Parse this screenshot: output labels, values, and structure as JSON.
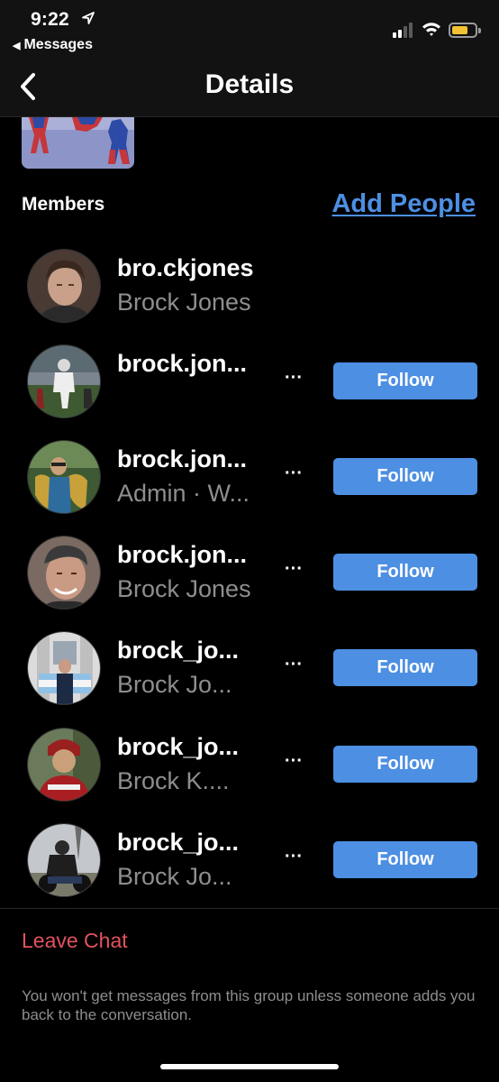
{
  "status_bar": {
    "time": "9:22",
    "back_app": "Messages",
    "signal_bars_on": 2,
    "battery_color": "#f1c232"
  },
  "nav": {
    "title": "Details"
  },
  "members_section": {
    "label": "Members",
    "add_people_label": "Add People",
    "accent_color": "#4d8fe3"
  },
  "members": [
    {
      "username": "bro.ckjones",
      "subtitle": "Brock Jones",
      "more": "",
      "follow": ""
    },
    {
      "username": "brock.jon...",
      "subtitle": "",
      "more": "···",
      "follow": "Follow"
    },
    {
      "username": "brock.jon...",
      "subtitle": "Admin · W...",
      "more": "···",
      "follow": "Follow"
    },
    {
      "username": "brock.jon...",
      "subtitle": "Brock Jones",
      "more": "···",
      "follow": "Follow"
    },
    {
      "username": "brock_jo...",
      "subtitle": "Brock Jo...",
      "more": "···",
      "follow": "Follow"
    },
    {
      "username": "brock_jo...",
      "subtitle": "Brock K....",
      "more": "···",
      "follow": "Follow"
    },
    {
      "username": "brock_jo...",
      "subtitle": "Brock Jo...",
      "more": "···",
      "follow": "Follow"
    }
  ],
  "footer": {
    "leave_chat": "Leave Chat",
    "leave_note": "You won't get messages from this group unless someone adds you back to the conversation.",
    "danger_color": "#e0535d"
  }
}
